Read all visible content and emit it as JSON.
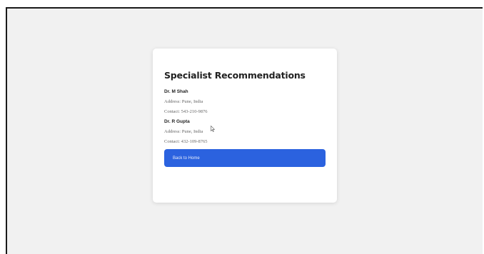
{
  "card": {
    "title": "Specialist Recommendations",
    "specialists": [
      {
        "name": "Dr. M Shah",
        "address": "Address: Pune, India",
        "contact": "Contact: 543-210-9876"
      },
      {
        "name": "Dr. R Gupta",
        "address": "Address: Pune, India",
        "contact": "Contact: 432-109-8765"
      }
    ],
    "back_label": "Back to Home"
  },
  "colors": {
    "background": "#f1f1f1",
    "card": "#ffffff",
    "button": "#2b62df"
  }
}
